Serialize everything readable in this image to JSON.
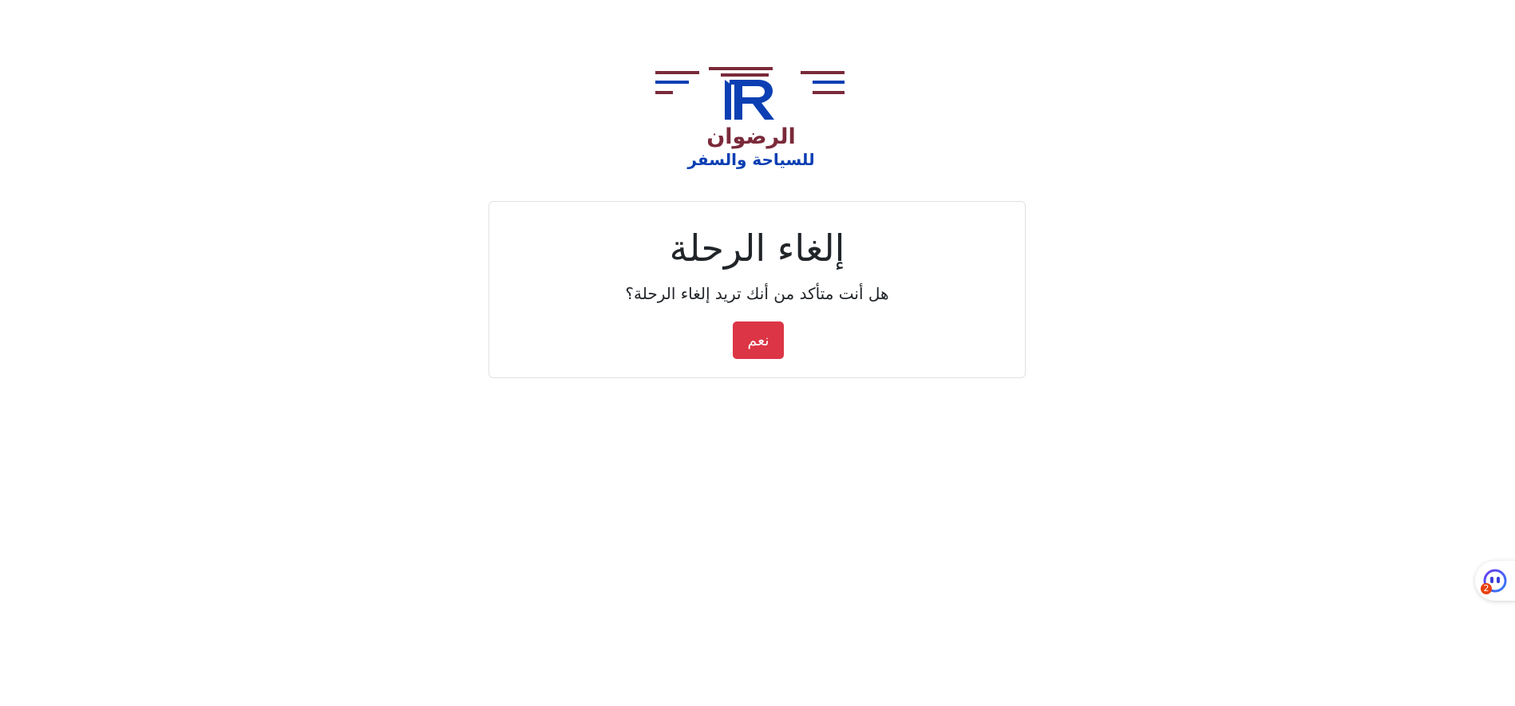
{
  "brand": {
    "name": "الرضوان",
    "tagline": "للسياحة والسفر",
    "primary_color": "#7a2a3a",
    "secondary_color": "#0b3fb3"
  },
  "dialog": {
    "title": "إلغاء الرحلة",
    "message": "هل أنت متأكد من أنك تريد إلغاء الرحلة؟",
    "confirm_label": "نعم",
    "confirm_color": "#dc3545"
  },
  "chat_widget": {
    "icon": "chat-bot-icon",
    "badge_count": "2"
  }
}
